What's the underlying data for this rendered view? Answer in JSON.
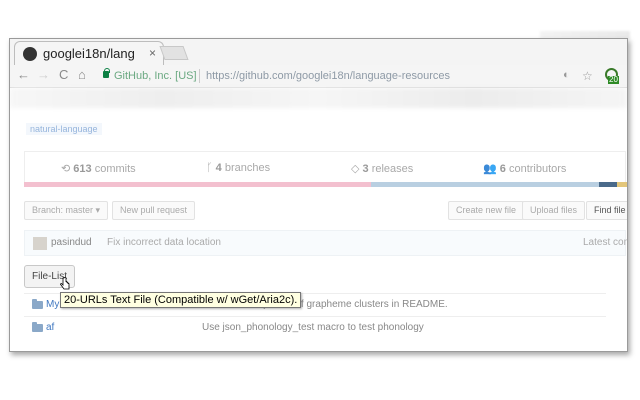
{
  "tab": {
    "title": "googlei18n/lang",
    "close": "×"
  },
  "toolbar": {
    "back": "←",
    "forward": "→",
    "reload": "C",
    "home": "⌂",
    "site_identity": "GitHub, Inc. [US]",
    "url": "https://github.com/googlei18n/language-resources",
    "star": "☆",
    "extension_badge": "20"
  },
  "repo": {
    "topic": "natural-language",
    "stats": {
      "commits_count": "613",
      "commits_label": "commits",
      "branches_count": "4",
      "branches_label": "branches",
      "releases_count": "3",
      "releases_label": "releases",
      "contributors_count": "6",
      "contributors_label": "contributors"
    },
    "branch_button": "Branch: master ▾",
    "new_pr_button": "New pull request",
    "create_file_button": "Create new file",
    "upload_button": "Upload files",
    "find_file_button": "Find file",
    "latest_commit": {
      "author": "pasindud",
      "message": "Fix incorrect data location",
      "label": "Latest com"
    },
    "files": [
      {
        "name": "Mym",
        "message": "Describe completion of grapheme clusters in README."
      },
      {
        "name": "af",
        "message": "Use json_phonology_test macro to test phonology"
      }
    ]
  },
  "extension": {
    "button_label": "File-List",
    "tooltip": "20-URLs Text File (Compatible w/ wGet/Aria2c)."
  },
  "colors": {
    "accent": "#4078c0",
    "tooltip_bg": "#ffffe1",
    "lang_pink": "#f3c0cf",
    "lang_blue": "#b8cfe0"
  }
}
